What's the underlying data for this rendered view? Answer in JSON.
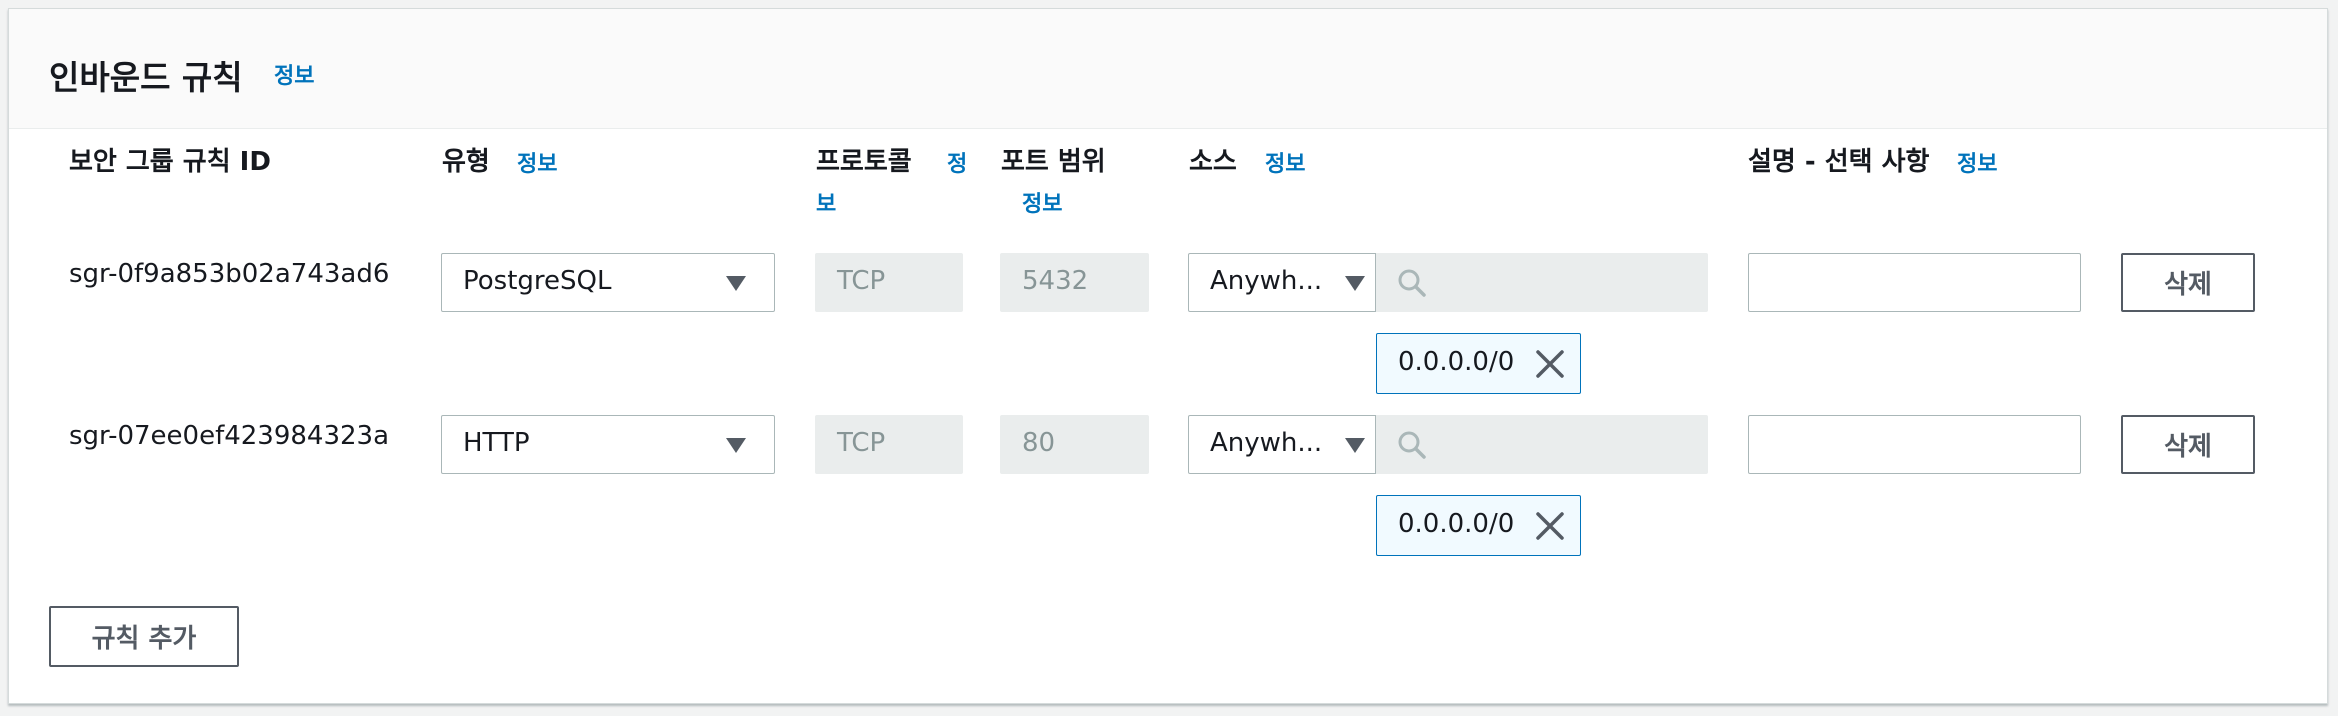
{
  "section": {
    "title": "인바운드 규칙",
    "info": "정보"
  },
  "columns": {
    "rule_id": "보안 그룹 규칙 ID",
    "type": "유형",
    "type_info": "정보",
    "protocol": "프로토콜",
    "protocol_info": "정보",
    "port_range": "포트 범위",
    "port_info": "정보",
    "source": "소스",
    "source_info": "정보",
    "description": "설명 - 선택 사항",
    "description_info": "정보"
  },
  "rules": [
    {
      "id": "sgr-0f9a853b02a743ad6",
      "type": "PostgreSQL",
      "protocol": "TCP",
      "port": "5432",
      "source": "Anywh...",
      "source_search": "",
      "cidr": "0.0.0.0/0",
      "description": "",
      "delete_label": "삭제"
    },
    {
      "id": "sgr-07ee0ef423984323a",
      "type": "HTTP",
      "protocol": "TCP",
      "port": "80",
      "source": "Anywh...",
      "source_search": "",
      "cidr": "0.0.0.0/0",
      "description": "",
      "delete_label": "삭제"
    }
  ],
  "add_rule_label": "규칙 추가",
  "icons": {
    "dropdown": "caret-down-icon",
    "search": "search-icon",
    "remove": "close-icon"
  },
  "colors": {
    "link": "#0073bb",
    "token_bg": "#f1faff",
    "disabled_bg": "#eaeded"
  }
}
